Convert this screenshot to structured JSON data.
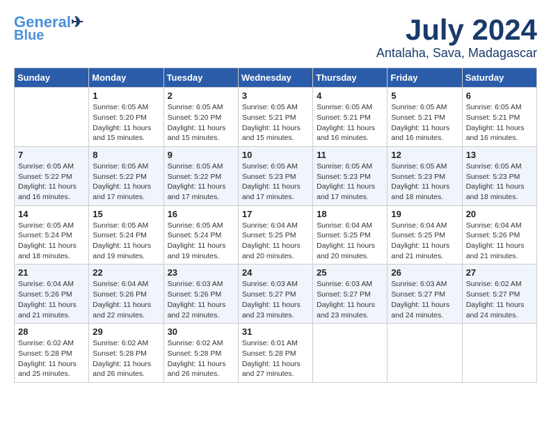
{
  "logo": {
    "line1": "General",
    "line2": "Blue"
  },
  "title": "July 2024",
  "location": "Antalaha, Sava, Madagascar",
  "weekdays": [
    "Sunday",
    "Monday",
    "Tuesday",
    "Wednesday",
    "Thursday",
    "Friday",
    "Saturday"
  ],
  "weeks": [
    [
      {
        "day": "",
        "sunrise": "",
        "sunset": "",
        "daylight": ""
      },
      {
        "day": "1",
        "sunrise": "Sunrise: 6:05 AM",
        "sunset": "Sunset: 5:20 PM",
        "daylight": "Daylight: 11 hours and 15 minutes."
      },
      {
        "day": "2",
        "sunrise": "Sunrise: 6:05 AM",
        "sunset": "Sunset: 5:20 PM",
        "daylight": "Daylight: 11 hours and 15 minutes."
      },
      {
        "day": "3",
        "sunrise": "Sunrise: 6:05 AM",
        "sunset": "Sunset: 5:21 PM",
        "daylight": "Daylight: 11 hours and 15 minutes."
      },
      {
        "day": "4",
        "sunrise": "Sunrise: 6:05 AM",
        "sunset": "Sunset: 5:21 PM",
        "daylight": "Daylight: 11 hours and 16 minutes."
      },
      {
        "day": "5",
        "sunrise": "Sunrise: 6:05 AM",
        "sunset": "Sunset: 5:21 PM",
        "daylight": "Daylight: 11 hours and 16 minutes."
      },
      {
        "day": "6",
        "sunrise": "Sunrise: 6:05 AM",
        "sunset": "Sunset: 5:21 PM",
        "daylight": "Daylight: 11 hours and 16 minutes."
      }
    ],
    [
      {
        "day": "7",
        "sunrise": "Sunrise: 6:05 AM",
        "sunset": "Sunset: 5:22 PM",
        "daylight": "Daylight: 11 hours and 16 minutes."
      },
      {
        "day": "8",
        "sunrise": "Sunrise: 6:05 AM",
        "sunset": "Sunset: 5:22 PM",
        "daylight": "Daylight: 11 hours and 17 minutes."
      },
      {
        "day": "9",
        "sunrise": "Sunrise: 6:05 AM",
        "sunset": "Sunset: 5:22 PM",
        "daylight": "Daylight: 11 hours and 17 minutes."
      },
      {
        "day": "10",
        "sunrise": "Sunrise: 6:05 AM",
        "sunset": "Sunset: 5:23 PM",
        "daylight": "Daylight: 11 hours and 17 minutes."
      },
      {
        "day": "11",
        "sunrise": "Sunrise: 6:05 AM",
        "sunset": "Sunset: 5:23 PM",
        "daylight": "Daylight: 11 hours and 17 minutes."
      },
      {
        "day": "12",
        "sunrise": "Sunrise: 6:05 AM",
        "sunset": "Sunset: 5:23 PM",
        "daylight": "Daylight: 11 hours and 18 minutes."
      },
      {
        "day": "13",
        "sunrise": "Sunrise: 6:05 AM",
        "sunset": "Sunset: 5:23 PM",
        "daylight": "Daylight: 11 hours and 18 minutes."
      }
    ],
    [
      {
        "day": "14",
        "sunrise": "Sunrise: 6:05 AM",
        "sunset": "Sunset: 5:24 PM",
        "daylight": "Daylight: 11 hours and 18 minutes."
      },
      {
        "day": "15",
        "sunrise": "Sunrise: 6:05 AM",
        "sunset": "Sunset: 5:24 PM",
        "daylight": "Daylight: 11 hours and 19 minutes."
      },
      {
        "day": "16",
        "sunrise": "Sunrise: 6:05 AM",
        "sunset": "Sunset: 5:24 PM",
        "daylight": "Daylight: 11 hours and 19 minutes."
      },
      {
        "day": "17",
        "sunrise": "Sunrise: 6:04 AM",
        "sunset": "Sunset: 5:25 PM",
        "daylight": "Daylight: 11 hours and 20 minutes."
      },
      {
        "day": "18",
        "sunrise": "Sunrise: 6:04 AM",
        "sunset": "Sunset: 5:25 PM",
        "daylight": "Daylight: 11 hours and 20 minutes."
      },
      {
        "day": "19",
        "sunrise": "Sunrise: 6:04 AM",
        "sunset": "Sunset: 5:25 PM",
        "daylight": "Daylight: 11 hours and 21 minutes."
      },
      {
        "day": "20",
        "sunrise": "Sunrise: 6:04 AM",
        "sunset": "Sunset: 5:26 PM",
        "daylight": "Daylight: 11 hours and 21 minutes."
      }
    ],
    [
      {
        "day": "21",
        "sunrise": "Sunrise: 6:04 AM",
        "sunset": "Sunset: 5:26 PM",
        "daylight": "Daylight: 11 hours and 21 minutes."
      },
      {
        "day": "22",
        "sunrise": "Sunrise: 6:04 AM",
        "sunset": "Sunset: 5:26 PM",
        "daylight": "Daylight: 11 hours and 22 minutes."
      },
      {
        "day": "23",
        "sunrise": "Sunrise: 6:03 AM",
        "sunset": "Sunset: 5:26 PM",
        "daylight": "Daylight: 11 hours and 22 minutes."
      },
      {
        "day": "24",
        "sunrise": "Sunrise: 6:03 AM",
        "sunset": "Sunset: 5:27 PM",
        "daylight": "Daylight: 11 hours and 23 minutes."
      },
      {
        "day": "25",
        "sunrise": "Sunrise: 6:03 AM",
        "sunset": "Sunset: 5:27 PM",
        "daylight": "Daylight: 11 hours and 23 minutes."
      },
      {
        "day": "26",
        "sunrise": "Sunrise: 6:03 AM",
        "sunset": "Sunset: 5:27 PM",
        "daylight": "Daylight: 11 hours and 24 minutes."
      },
      {
        "day": "27",
        "sunrise": "Sunrise: 6:02 AM",
        "sunset": "Sunset: 5:27 PM",
        "daylight": "Daylight: 11 hours and 24 minutes."
      }
    ],
    [
      {
        "day": "28",
        "sunrise": "Sunrise: 6:02 AM",
        "sunset": "Sunset: 5:28 PM",
        "daylight": "Daylight: 11 hours and 25 minutes."
      },
      {
        "day": "29",
        "sunrise": "Sunrise: 6:02 AM",
        "sunset": "Sunset: 5:28 PM",
        "daylight": "Daylight: 11 hours and 26 minutes."
      },
      {
        "day": "30",
        "sunrise": "Sunrise: 6:02 AM",
        "sunset": "Sunset: 5:28 PM",
        "daylight": "Daylight: 11 hours and 26 minutes."
      },
      {
        "day": "31",
        "sunrise": "Sunrise: 6:01 AM",
        "sunset": "Sunset: 5:28 PM",
        "daylight": "Daylight: 11 hours and 27 minutes."
      },
      {
        "day": "",
        "sunrise": "",
        "sunset": "",
        "daylight": ""
      },
      {
        "day": "",
        "sunrise": "",
        "sunset": "",
        "daylight": ""
      },
      {
        "day": "",
        "sunrise": "",
        "sunset": "",
        "daylight": ""
      }
    ]
  ]
}
